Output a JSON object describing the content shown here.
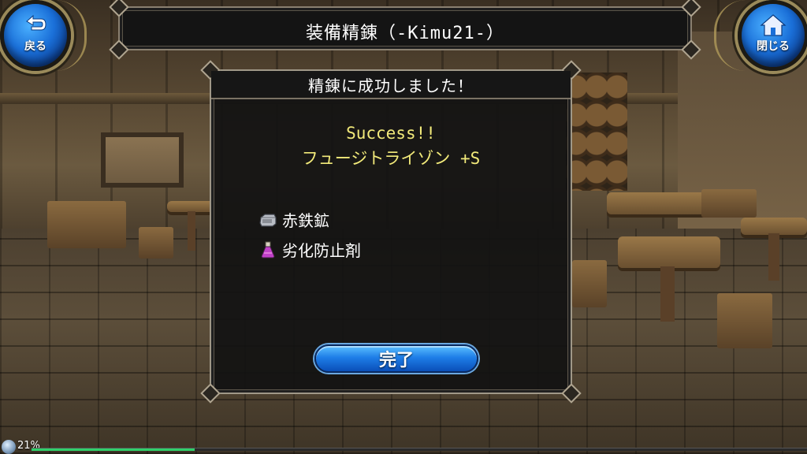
{
  "header": {
    "title": "装備精錬（-Kimu21-）"
  },
  "nav": {
    "back_label": "戻る",
    "close_label": "閉じる",
    "back_icon": "back-arrow-icon",
    "close_icon": "home-icon"
  },
  "dialog": {
    "title": "精錬に成功しました！",
    "success_text": "Success!!",
    "item_name": "フュージトライゾン +S",
    "materials": [
      {
        "name": "赤鉄鉱",
        "icon": "ore-icon"
      },
      {
        "name": "劣化防止剤",
        "icon": "potion-icon"
      }
    ],
    "done_label": "完了"
  },
  "status": {
    "exp_percent_label": "21%",
    "exp_fraction": 0.21
  },
  "colors": {
    "result_text": "#f2ea7a",
    "button_blue": "#1e7ee8",
    "exp_green": "#2fd06a"
  }
}
